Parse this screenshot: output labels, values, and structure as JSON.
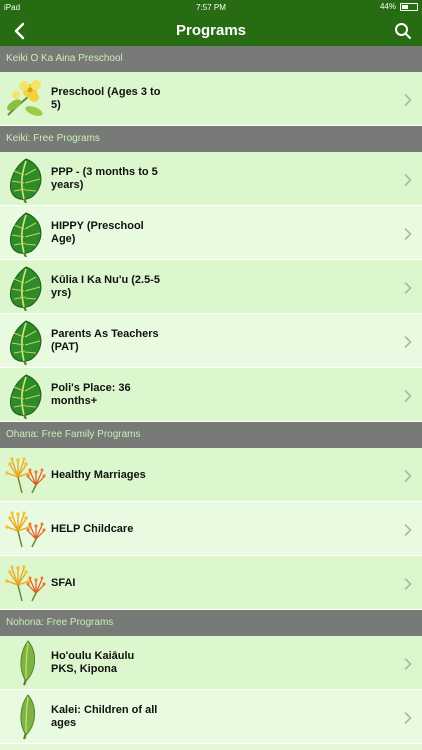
{
  "status_bar": {
    "device": "iPad",
    "time": "7:57 PM",
    "battery": "44%",
    "battery_level": 0.44
  },
  "nav": {
    "title": "Programs"
  },
  "sections": [
    {
      "title": "Keiki O Ka Aina Preschool",
      "items": [
        {
          "label": "Preschool (Ages 3 to 5)",
          "icon": "yellow-hibiscus-icon"
        }
      ]
    },
    {
      "title": "Keiki: Free Programs",
      "items": [
        {
          "label": "PPP - (3 months to 5 years)",
          "icon": "taro-leaf-icon"
        },
        {
          "label": "HIPPY (Preschool Age)",
          "icon": "taro-leaf-icon"
        },
        {
          "label": "Kūlia I Ka Nu'u (2.5-5 yrs)",
          "icon": "taro-leaf-icon"
        },
        {
          "label": "Parents As Teachers (PAT)",
          "icon": "taro-leaf-icon"
        },
        {
          "label": "Poli's Place: 36 months+",
          "icon": "taro-leaf-icon"
        }
      ]
    },
    {
      "title": "Ohana: Free Family Programs",
      "items": [
        {
          "label": "Healthy Marriages",
          "icon": "lehua-blossom-icon"
        },
        {
          "label": "HELP Childcare",
          "icon": "lehua-blossom-icon"
        },
        {
          "label": "SFAI",
          "icon": "lehua-blossom-icon"
        }
      ]
    },
    {
      "title": "Nohona: Free Programs",
      "items": [
        {
          "label": "Ho'oulu Kaiāulu PKS, Kipona",
          "icon": "ti-leaf-icon"
        },
        {
          "label": "Kalei: Children of all ages",
          "icon": "ti-leaf-icon"
        }
      ]
    }
  ],
  "colors": {
    "nav": "#276b12",
    "section_header": "#777a76",
    "section_text": "#c9f0b9",
    "row_odd": "#dcf7cd",
    "row_even": "#e8fbe0"
  }
}
